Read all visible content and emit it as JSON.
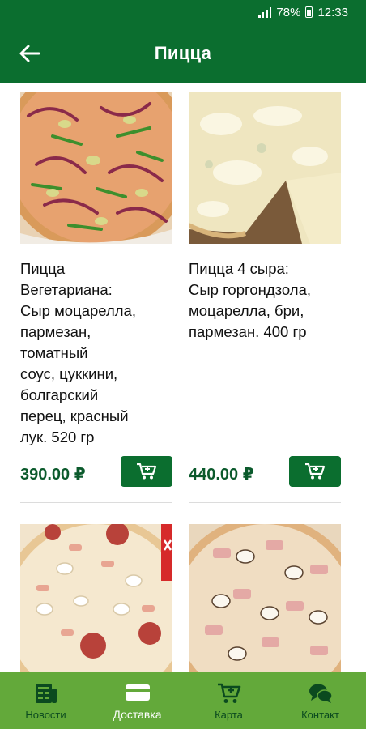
{
  "status_bar": {
    "battery": "78%",
    "time": "12:33"
  },
  "header": {
    "title": "Пицца"
  },
  "products": [
    {
      "description": "Пицца\nВегетариана:\nСыр моцарелла,\nпармезан,\nтоматный\nсоус, цуккини,\nболгарский\nперец, красный\nлук. 520 гр",
      "price": "390.00 ₽",
      "image": "vegetarian-pizza-photo"
    },
    {
      "description": "Пицца 4 сыра:\nСыр горгондзола,\nмоцарелла, бри,\nпармезан. 400 гр",
      "price": "440.00 ₽",
      "image": "four-cheese-pizza-photo"
    },
    {
      "image": "salami-mushroom-pizza-photo"
    },
    {
      "image": "ham-mushroom-pizza-photo"
    }
  ],
  "bottom_nav": [
    {
      "label": "Новости",
      "icon": "news-icon",
      "active": false
    },
    {
      "label": "Доставка",
      "icon": "delivery-card-icon",
      "active": true
    },
    {
      "label": "Карта",
      "icon": "cart-icon",
      "active": false
    },
    {
      "label": "Контакт",
      "icon": "chat-icon",
      "active": false
    }
  ],
  "colors": {
    "primary": "#0b6e2f",
    "nav_bar": "#63a93a",
    "price": "#0b5a2c"
  }
}
